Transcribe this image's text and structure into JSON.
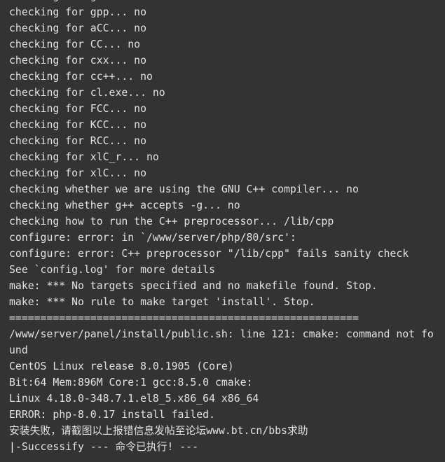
{
  "terminal": {
    "background": "#333333",
    "text_color": "#e2e2e2",
    "lines": [
      "checking for g++... no",
      "checking for gpp... no",
      "checking for aCC... no",
      "checking for CC... no",
      "checking for cxx... no",
      "checking for cc++... no",
      "checking for cl.exe... no",
      "checking for FCC... no",
      "checking for KCC... no",
      "checking for RCC... no",
      "checking for xlC_r... no",
      "checking for xlC... no",
      "checking whether we are using the GNU C++ compiler... no",
      "checking whether g++ accepts -g... no",
      "checking how to run the C++ preprocessor... /lib/cpp",
      "configure: error: in `/www/server/php/80/src':",
      "configure: error: C++ preprocessor \"/lib/cpp\" fails sanity check",
      "See `config.log' for more details",
      "make: *** No targets specified and no makefile found. Stop.",
      "make: *** No rule to make target 'install'. Stop.",
      "========================================================",
      "/www/server/panel/install/public.sh: line 121: cmake: command not fo",
      "und",
      "CentOS Linux release 8.0.1905 (Core)",
      "Bit:64 Mem:896M Core:1 gcc:8.5.0 cmake:",
      "Linux 4.18.0-348.7.1.el8_5.x86_64 x86_64",
      "ERROR: php-8.0.17 install failed.",
      "安装失败，请截图以上报错信息发帖至论坛www.bt.cn/bbs求助"
    ],
    "final_line": {
      "prefix": "|",
      "text": "-Successify --- 命令已执行! ---"
    }
  }
}
